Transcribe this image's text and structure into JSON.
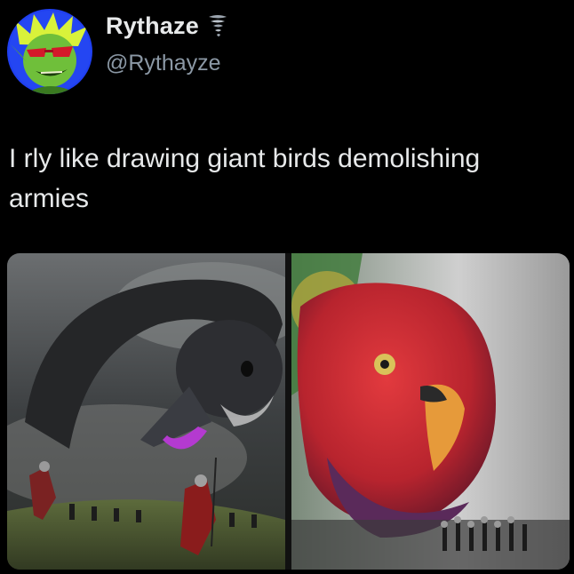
{
  "author": {
    "display_name": "Rythaze",
    "handle": "@Rythayze",
    "avatar_icon": "green-goblin-avatar",
    "name_emoji": "tornado-icon"
  },
  "tweet": {
    "text": "I rly like drawing giant birds demolishing armies"
  },
  "media": {
    "images": [
      {
        "icon": "giant-goose-painting"
      },
      {
        "icon": "giant-parrot-painting"
      }
    ]
  },
  "colors": {
    "background": "#000000",
    "text": "#e7e9ea",
    "secondary_text": "#8b98a5",
    "avatar_background": "#1f3ff0",
    "avatar_skin": "#6fbf3a"
  }
}
